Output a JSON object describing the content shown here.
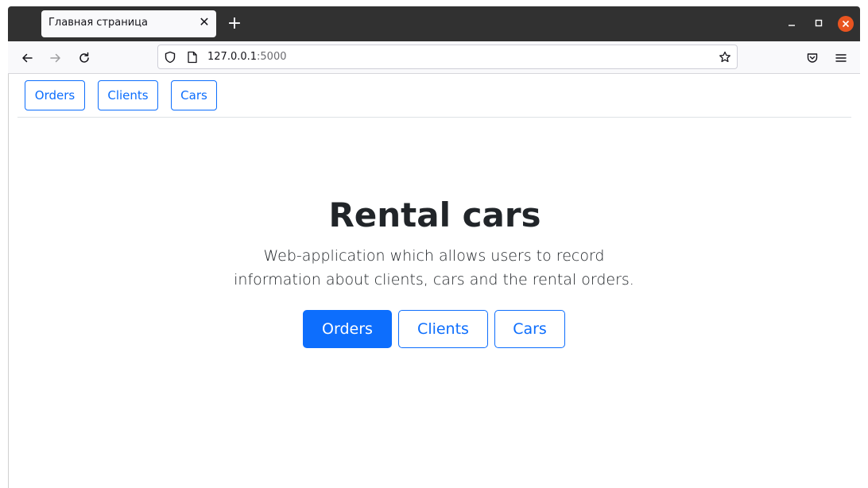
{
  "browser": {
    "tab_title": "Главная страница",
    "url_host": "127.0.0.1",
    "url_port": ":5000",
    "icons": {
      "back": "back-arrow-icon",
      "forward": "forward-arrow-icon",
      "reload": "reload-icon",
      "shield": "shield-icon",
      "page": "page-icon",
      "bookmark": "star-icon",
      "pocket": "pocket-icon",
      "menu": "hamburger-menu-icon",
      "new_tab": "plus-icon",
      "close_tab": "close-icon"
    },
    "colors": {
      "titlebar": "#313131",
      "close_button": "#e95420"
    }
  },
  "nav": {
    "orders": "Orders",
    "clients": "Clients",
    "cars": "Cars"
  },
  "hero": {
    "title": "Rental cars",
    "lead": "Web-application which allows users to record information about clients, cars and the rental orders.",
    "buttons": {
      "orders": "Orders",
      "clients": "Clients",
      "cars": "Cars"
    }
  },
  "colors": {
    "primary": "#0d6efd",
    "text": "#212529"
  }
}
